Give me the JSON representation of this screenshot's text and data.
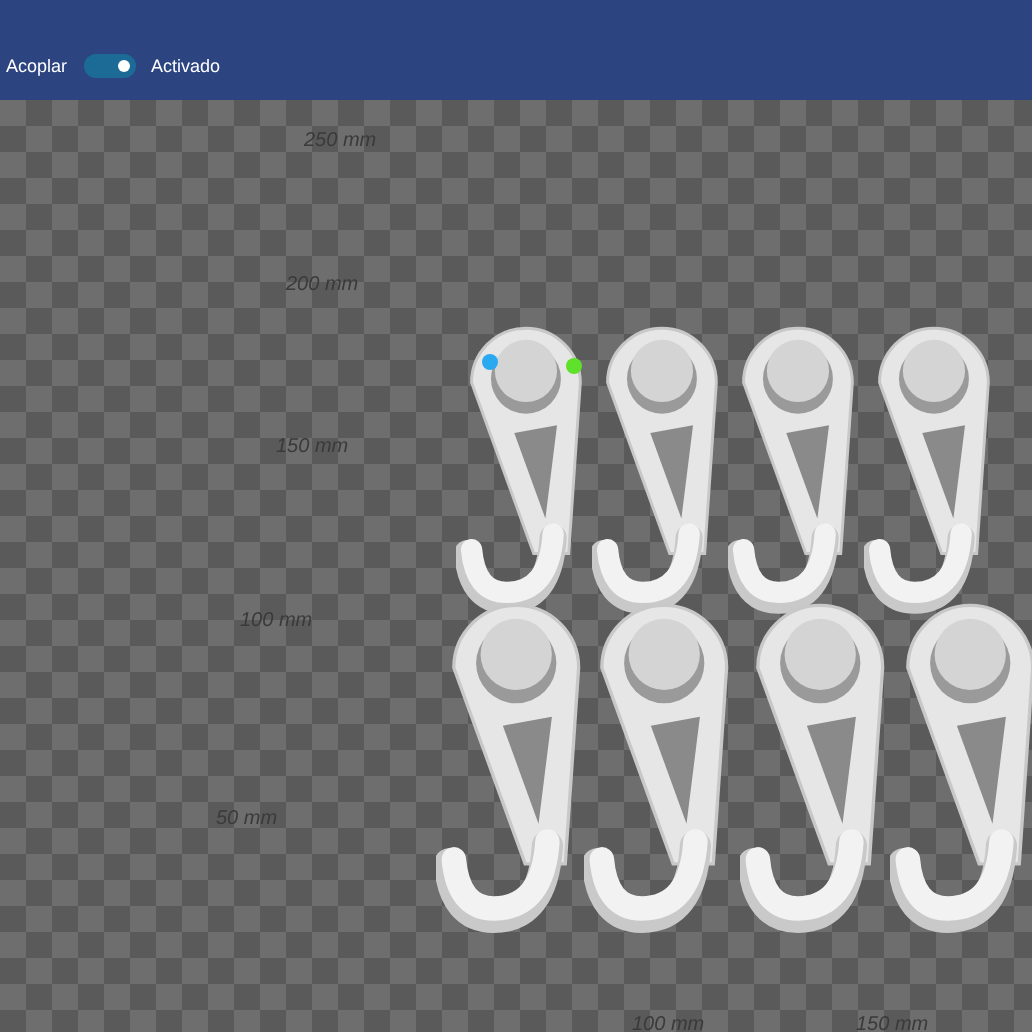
{
  "toolbar": {
    "label": "Acoplar",
    "toggle": {
      "on": true
    },
    "status": "Activado"
  },
  "viewport": {
    "scale_labels": [
      "250 mm",
      "200 mm",
      "150 mm",
      "100 mm",
      "50 mm",
      "100 mm",
      "150 mm"
    ]
  }
}
